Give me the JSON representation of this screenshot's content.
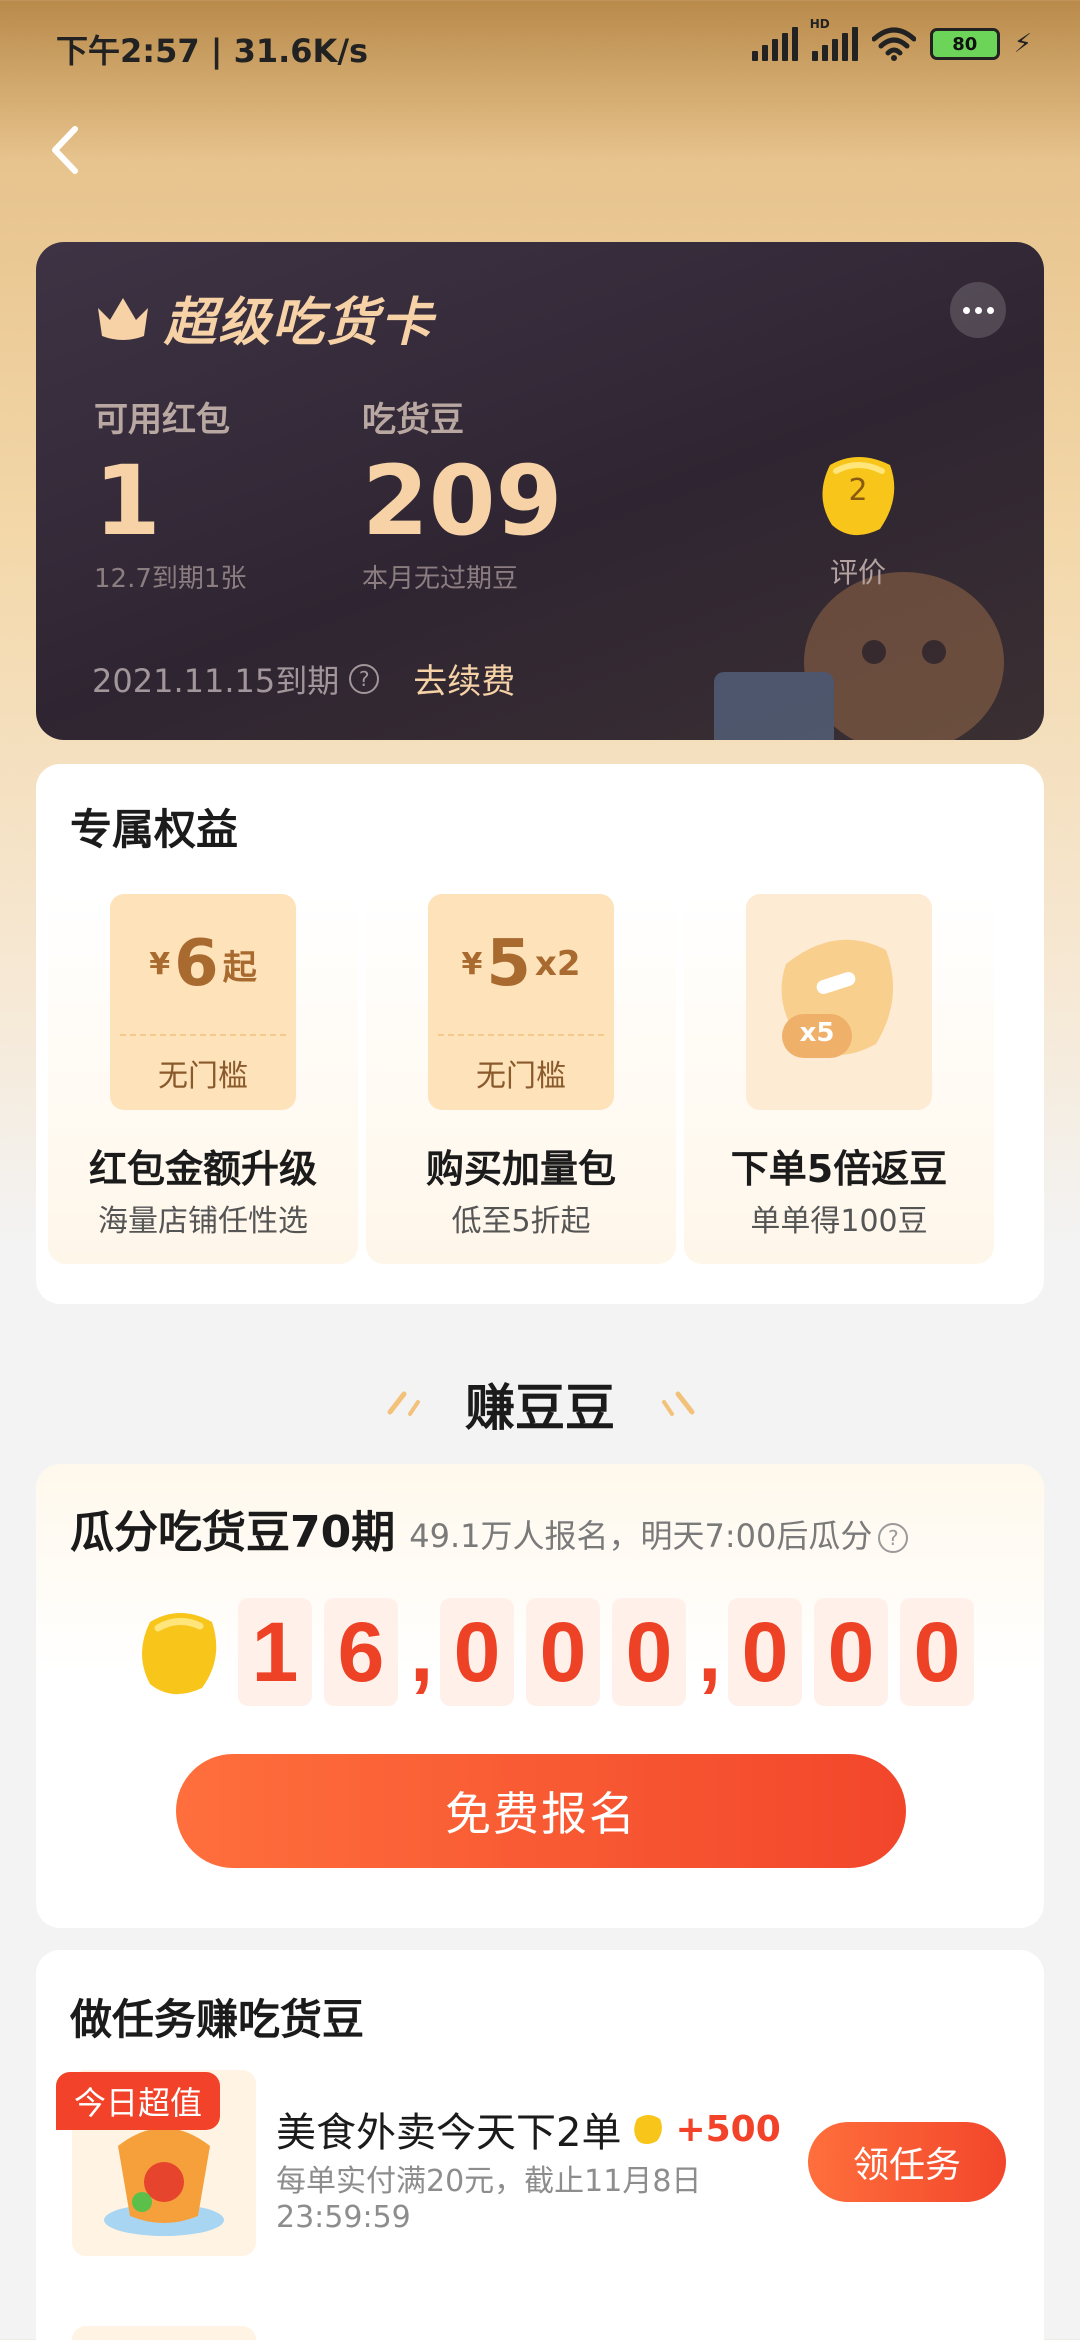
{
  "status_bar": {
    "time": "下午2:57 | 31.6K/s",
    "battery": "80",
    "hd_label": "HD"
  },
  "nav": {
    "back_icon": "chevron-left-icon"
  },
  "member_card": {
    "title": "超级吃货卡",
    "crown_icon": "crown-icon",
    "more_icon": "more-dots-icon",
    "red_packet": {
      "label": "可用红包",
      "value": "1",
      "sub": "12.7到期1张"
    },
    "beans": {
      "label": "吃货豆",
      "value": "209",
      "sub": "本月无过期豆"
    },
    "review": {
      "badge": "2",
      "label": "评价"
    },
    "expiry": "2021.11.15到期",
    "help_icon": "?",
    "renew": "去续费"
  },
  "benefits": {
    "title": "专属权益",
    "items": [
      {
        "currency": "¥",
        "amount": "6",
        "suffix": "起",
        "tag": "无门槛",
        "name": "红包金额升级",
        "desc": "海量店铺任性选"
      },
      {
        "currency": "¥",
        "amount": "5",
        "suffix": "x2",
        "tag": "无门槛",
        "name": "购买加量包",
        "desc": "低至5折起"
      },
      {
        "badge": "x5",
        "name": "下单5倍返豆",
        "desc": "单单得100豆"
      }
    ]
  },
  "earn": {
    "title": "赚豆豆",
    "split": {
      "title": "瓜分吃货豆70期",
      "info": "49.1万人报名，明天7:00后瓜分",
      "help_icon": "?",
      "digits": [
        "1",
        "6",
        ",",
        "0",
        "0",
        "0",
        ",",
        "0",
        "0",
        "0"
      ],
      "button": "免费报名"
    }
  },
  "tasks": {
    "title": "做任务赚吃货豆",
    "items": [
      {
        "tag": "今日超值",
        "title": "美食外卖今天下2单",
        "reward": "+500",
        "desc": "每单实付满20元，截止11月8日23:59:59",
        "button": "领任务"
      }
    ]
  },
  "colors": {
    "accent": "#f2462b",
    "card_bg": "#2f2532",
    "gold_text": "#f6d2a6",
    "coupon": "#fde2ba"
  }
}
